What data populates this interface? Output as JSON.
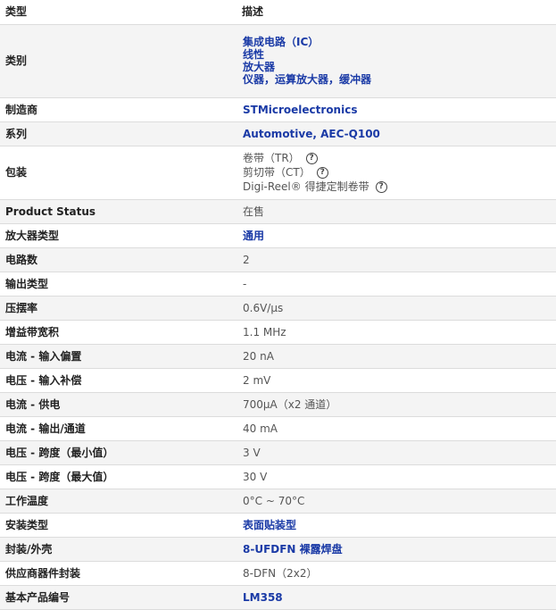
{
  "header": {
    "type": "类型",
    "description": "描述"
  },
  "rows": [
    {
      "label": "类别",
      "values": [
        "集成电路（IC）",
        "线性",
        "放大器",
        "仪器，运算放大器，缓冲器"
      ]
    },
    {
      "label": "制造商",
      "value": "STMicroelectronics"
    },
    {
      "label": "系列",
      "value": "Automotive, AEC-Q100"
    },
    {
      "label": "包装",
      "values": [
        "卷带（TR）",
        "剪切带（CT）",
        "Digi-Reel® 得捷定制卷带"
      ],
      "help_icon": "question-circle-icon"
    },
    {
      "label": "Product Status",
      "value": "在售"
    },
    {
      "label": "放大器类型",
      "value": "通用"
    },
    {
      "label": "电路数",
      "value": "2"
    },
    {
      "label": "输出类型",
      "value": "-"
    },
    {
      "label": "压摆率",
      "value": "0.6V/µs"
    },
    {
      "label": "增益带宽积",
      "value": "1.1 MHz"
    },
    {
      "label": "电流 - 输入偏置",
      "value": "20 nA"
    },
    {
      "label": "电压 - 输入补偿",
      "value": "2 mV"
    },
    {
      "label": "电流 - 供电",
      "value": "700µA（x2 通道）"
    },
    {
      "label": "电流 - 输出/通道",
      "value": "40 mA"
    },
    {
      "label": "电压 - 跨度（最小值）",
      "value": "3 V"
    },
    {
      "label": "电压 - 跨度（最大值）",
      "value": "30 V"
    },
    {
      "label": "工作温度",
      "value": "0°C ~ 70°C"
    },
    {
      "label": "安装类型",
      "value": "表面贴装型"
    },
    {
      "label": "封装/外壳",
      "value": "8-UFDFN 裸露焊盘"
    },
    {
      "label": "供应商器件封装",
      "value": "8-DFN（2x2）"
    },
    {
      "label": "基本产品编号",
      "value": "LM358"
    }
  ],
  "colors": {
    "link": "#1a3aa6",
    "row_alt": "#f4f4f4",
    "border": "#dcdcdc"
  }
}
